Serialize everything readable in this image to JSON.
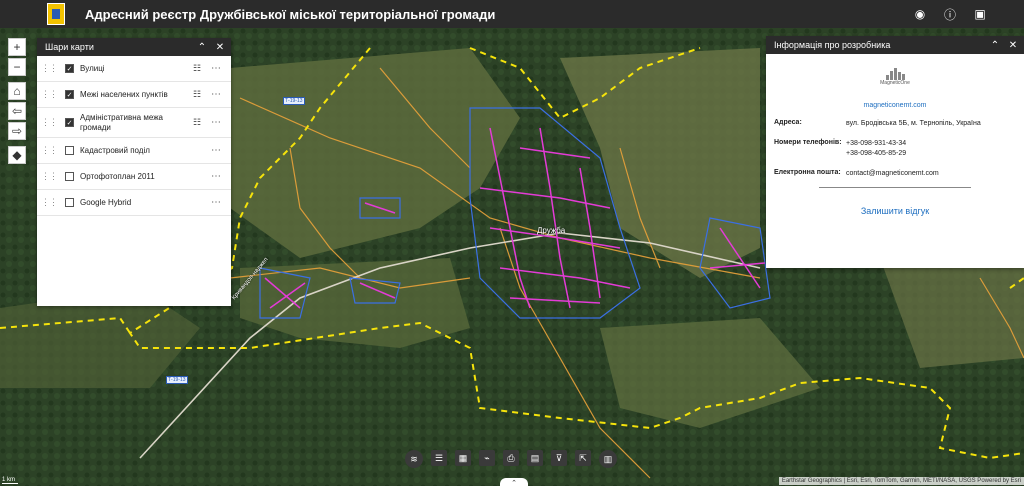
{
  "app": {
    "title": "Адресний реєстр Дружбівської міської територіальної громади"
  },
  "header_icons": [
    "account-icon",
    "info-icon",
    "save-icon"
  ],
  "map": {
    "city_label": "Дружба",
    "road_badges": [
      "Т-19-13",
      "Т-19-13"
    ],
    "street_label": "Кривандоп‑наджеп",
    "scale_text": "1 km",
    "attribution": "Earthstar Geographics | Esri, Esri, TomTom, Garmin, METI/NASA, USGS    Powered by Esri"
  },
  "layers_panel": {
    "title": "Шари карти",
    "items": [
      {
        "label": "Вулиці",
        "checked": true,
        "legend": true
      },
      {
        "label": "Межі населених пунктів",
        "checked": true,
        "legend": true
      },
      {
        "label": "Адміністративна межа громади",
        "checked": true,
        "legend": true
      },
      {
        "label": "Кадастровий поділ",
        "checked": false,
        "legend": false
      },
      {
        "label": "Ортофотоплан 2011",
        "checked": false,
        "legend": false
      },
      {
        "label": "Google Hybrid",
        "checked": false,
        "legend": false
      }
    ]
  },
  "info_panel": {
    "title": "Інформація про розробника",
    "brand_name": "MagneticOne",
    "link": "magneticonemt.com",
    "address_key": "Адреса:",
    "address_val": "вул. Бродівська 5Б, м. Тернопіль, Україна",
    "phones_key": "Номери телефонів:",
    "phone1": "+38-098-931-43-34",
    "phone2": "+38-098-405-85-29",
    "email_key": "Електронна пошта:",
    "email_val": "contact@magneticonemt.com",
    "feedback": "Залишити відгук"
  },
  "toolbar": [
    "layers-icon",
    "list-icon",
    "grid-icon",
    "measure-icon",
    "print-icon",
    "bookmark-icon",
    "filter-icon",
    "share-icon",
    "table-icon"
  ],
  "colors": {
    "header_bg": "#2b2b2b",
    "boundary": "#f5e30b",
    "streets": "#e33bd6",
    "settlements": "#3b6fe3",
    "roads": "#e9a23a",
    "link": "#1f6fc0"
  }
}
